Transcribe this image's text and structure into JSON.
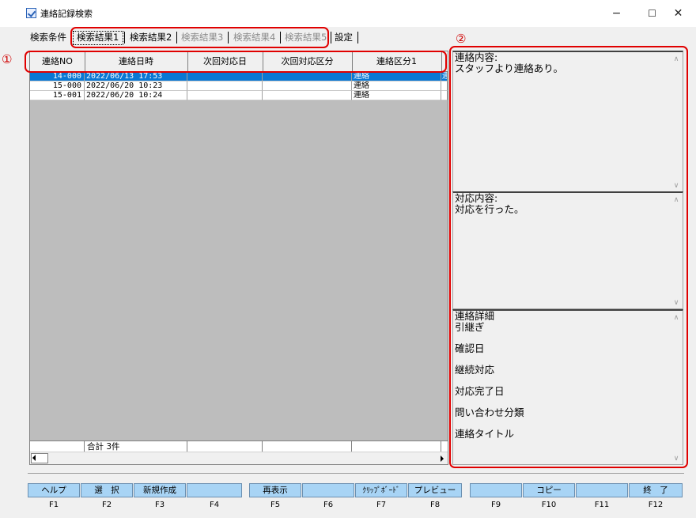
{
  "window": {
    "title": "連絡記録検索",
    "controls": {
      "minimize": "−",
      "maximize": "☐",
      "close": "✕"
    }
  },
  "tabs": [
    {
      "label": "検索条件",
      "state": "normal"
    },
    {
      "label": "検索結果1",
      "state": "active"
    },
    {
      "label": "検索結果2",
      "state": "normal"
    },
    {
      "label": "検索結果3",
      "state": "disabled"
    },
    {
      "label": "検索結果4",
      "state": "disabled"
    },
    {
      "label": "検索結果5",
      "state": "disabled"
    },
    {
      "label": "設定",
      "state": "normal"
    }
  ],
  "grid": {
    "columns": [
      "連絡NO",
      "連絡日時",
      "次回対応日",
      "次回対応区分",
      "連絡区分1",
      ""
    ],
    "rows": [
      {
        "no": "14-000",
        "datetime": "2022/06/13 17:53",
        "next_date": "",
        "next_type": "",
        "type1": "連絡",
        "extra": "連",
        "selected": true
      },
      {
        "no": "15-000",
        "datetime": "2022/06/20 10:23",
        "next_date": "",
        "next_type": "",
        "type1": "連絡",
        "extra": "",
        "selected": false
      },
      {
        "no": "15-001",
        "datetime": "2022/06/20 10:24",
        "next_date": "",
        "next_type": "",
        "type1": "連絡",
        "extra": "",
        "selected": false
      }
    ],
    "footer": {
      "total": "合計 3件"
    }
  },
  "detail": {
    "contact_content": "連絡内容:\nスタッフより連絡あり。",
    "response_content": "対応内容:\n対応を行った。",
    "contact_details": "連絡詳細\n引継ぎ\n\n確認日\n\n継続対応\n\n対応完了日\n\n問い合わせ分類\n\n連絡タイトル"
  },
  "annotations": {
    "grid_marker": "①",
    "detail_marker": "②",
    "color": "#e00000"
  },
  "function_keys": [
    {
      "key": "F1",
      "label": "ヘルプ"
    },
    {
      "key": "F2",
      "label": "選　択"
    },
    {
      "key": "F3",
      "label": "新規作成"
    },
    {
      "key": "F4",
      "label": ""
    },
    {
      "key": "F5",
      "label": "再表示"
    },
    {
      "key": "F6",
      "label": ""
    },
    {
      "key": "F7",
      "label": "ｸﾘｯﾌﾟﾎﾞｰﾄﾞ"
    },
    {
      "key": "F8",
      "label": "プレビュー"
    },
    {
      "key": "F9",
      "label": ""
    },
    {
      "key": "F10",
      "label": "コピー"
    },
    {
      "key": "F11",
      "label": ""
    },
    {
      "key": "F12",
      "label": "終　了"
    }
  ],
  "colors": {
    "selection": "#0a78d4",
    "fkey_button": "#a8d4f5",
    "grid_background": "#bdbdbd"
  }
}
